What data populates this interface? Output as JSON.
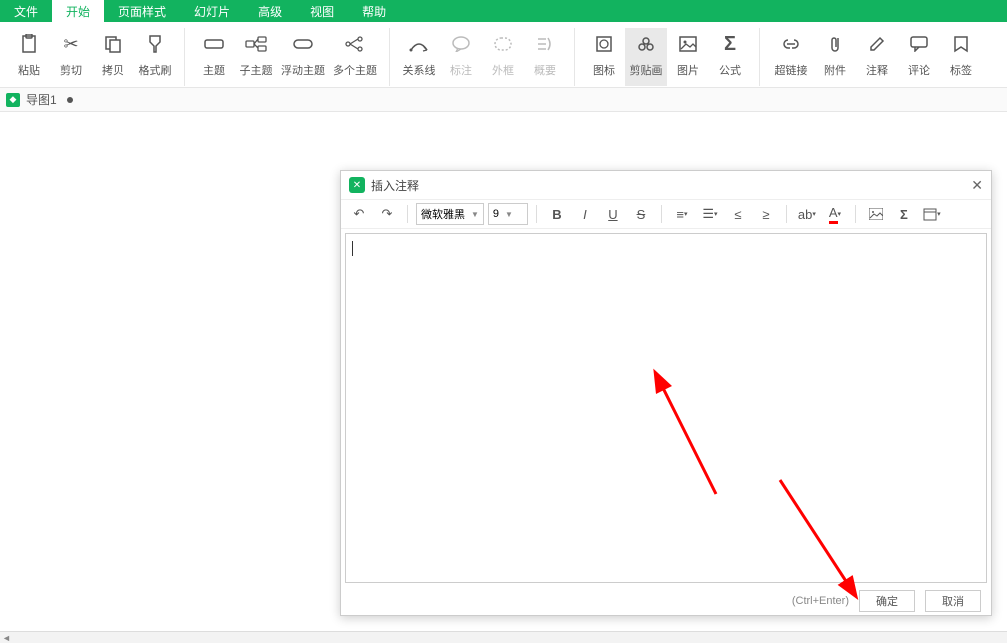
{
  "menu": {
    "items": [
      "文件",
      "开始",
      "页面样式",
      "幻灯片",
      "高级",
      "视图",
      "帮助"
    ],
    "active": 1
  },
  "ribbon": {
    "g1": [
      {
        "label": "粘贴",
        "icon": "clipboard"
      },
      {
        "label": "剪切",
        "icon": "scissors"
      },
      {
        "label": "拷贝",
        "icon": "copy"
      },
      {
        "label": "格式刷",
        "icon": "brush"
      }
    ],
    "g2": [
      {
        "label": "主题",
        "icon": "theme"
      },
      {
        "label": "子主题",
        "icon": "subtheme"
      },
      {
        "label": "浮动主题",
        "icon": "float"
      },
      {
        "label": "多个主题",
        "icon": "multi"
      }
    ],
    "g3": [
      {
        "label": "关系线",
        "icon": "relation"
      },
      {
        "label": "标注",
        "icon": "callout",
        "disabled": true
      },
      {
        "label": "外框",
        "icon": "boundary",
        "disabled": true
      },
      {
        "label": "概要",
        "icon": "summary",
        "disabled": true
      }
    ],
    "g4": [
      {
        "label": "图标",
        "icon": "iconset"
      },
      {
        "label": "剪贴画",
        "icon": "clipart",
        "selected": true
      },
      {
        "label": "图片",
        "icon": "image"
      },
      {
        "label": "公式",
        "icon": "formula"
      }
    ],
    "g5": [
      {
        "label": "超链接",
        "icon": "link"
      },
      {
        "label": "附件",
        "icon": "attach"
      },
      {
        "label": "注释",
        "icon": "note"
      },
      {
        "label": "评论",
        "icon": "comment"
      },
      {
        "label": "标签",
        "icon": "tag"
      }
    ]
  },
  "doc": {
    "name": "导图1"
  },
  "dialog": {
    "title": "插入注释",
    "font": "微软雅黑",
    "size": "9",
    "hint": "(Ctrl+Enter)",
    "ok": "确定",
    "cancel": "取消"
  }
}
